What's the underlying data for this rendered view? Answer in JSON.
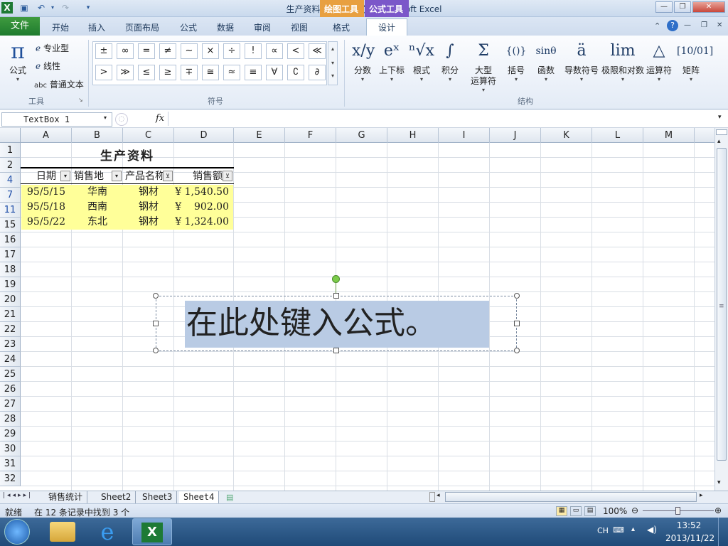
{
  "window": {
    "title": "生产资料1  [兼容模式] - Microsoft Excel",
    "context_tabs": [
      "绘图工具",
      "公式工具"
    ],
    "colors": {
      "drawing_tools": "#e8a040",
      "equation_tools": "#7b57c9",
      "file_tab": "#2a8a3a"
    }
  },
  "ribbon_tabs": [
    "文件",
    "开始",
    "插入",
    "页面布局",
    "公式",
    "数据",
    "审阅",
    "视图",
    "格式",
    "设计"
  ],
  "ribbon": {
    "tools_group": {
      "formula_label": "公式",
      "professional_label": "专业型",
      "linear_label": "线性",
      "normal_text_label": "普通文本",
      "group_label": "工具"
    },
    "symbols": [
      "±",
      "∞",
      "=",
      "≠",
      "~",
      "×",
      "÷",
      "!",
      "∝",
      "<",
      "≪",
      ">",
      "≫",
      "≤",
      "≥",
      "∓",
      "≅",
      "≈",
      "≡",
      "∀",
      "∁",
      "∂"
    ],
    "symbols_group_label": "符号",
    "structures": [
      {
        "icon": "x/y",
        "label": "分数"
      },
      {
        "icon": "eˣ",
        "label": "上下标"
      },
      {
        "icon": "ⁿ√x",
        "label": "根式"
      },
      {
        "icon": "∫",
        "label": "积分"
      },
      {
        "icon": "Σ",
        "label": "大型\n运算符"
      },
      {
        "icon": "{()}",
        "label": "括号"
      },
      {
        "icon": "sinθ",
        "label": "函数"
      },
      {
        "icon": "ä",
        "label": "导数符号"
      },
      {
        "icon": "lim",
        "label": "极限和对数"
      },
      {
        "icon": "△",
        "label": "运算符"
      },
      {
        "icon": "[10/01]",
        "label": "矩阵"
      }
    ],
    "structures_group_label": "结构"
  },
  "formula_bar": {
    "name_box": "TextBox 1",
    "fx": "fx",
    "value": ""
  },
  "columns": [
    "A",
    "B",
    "C",
    "D",
    "E",
    "F",
    "G",
    "H",
    "I",
    "J",
    "K",
    "L",
    "M"
  ],
  "rows": [
    "1",
    "2",
    "4",
    "7",
    "11",
    "15",
    "16",
    "17",
    "18",
    "19",
    "20",
    "21",
    "22",
    "23",
    "24",
    "25",
    "26",
    "27",
    "28",
    "29",
    "30",
    "31",
    "32"
  ],
  "sheet": {
    "title": "生产资料",
    "headers": [
      "日期",
      "销售地",
      "产品名称",
      "销售额"
    ],
    "data": [
      [
        "95/5/15",
        "华南",
        "钢材",
        "¥ 1,540.50"
      ],
      [
        "95/5/18",
        "西南",
        "钢材",
        "¥    902.00"
      ],
      [
        "95/5/22",
        "东北",
        "钢材",
        "¥ 1,324.00"
      ]
    ]
  },
  "textbox": {
    "text": "在此处键入公式。"
  },
  "sheet_tabs": [
    "销售统计",
    "Sheet2",
    "Sheet3",
    "Sheet4"
  ],
  "status": {
    "ready": "就绪",
    "filter_info": "在 12 条记录中找到 3 个",
    "zoom": "100%"
  },
  "taskbar": {
    "lang": "CH",
    "time": "13:52",
    "date": "2013/11/22"
  }
}
